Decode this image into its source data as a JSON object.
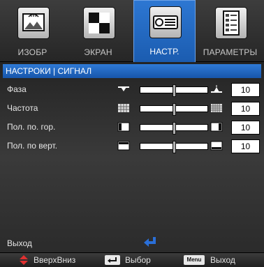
{
  "tabs": [
    {
      "label": "ИЗОБР",
      "icon": "image-icon",
      "active": false
    },
    {
      "label": "ЭКРАН",
      "icon": "screen-pattern-icon",
      "active": false
    },
    {
      "label": "НАСТР.",
      "icon": "projector-icon",
      "active": true
    },
    {
      "label": "ПАРАМЕТРЫ",
      "icon": "options-list-icon",
      "active": false
    }
  ],
  "panel": {
    "title": "НАСТРОКИ | СИГНАЛ",
    "rows": [
      {
        "label": "Фаза",
        "value": "10",
        "level": 0.5
      },
      {
        "label": "Частота",
        "value": "10",
        "level": 0.5
      },
      {
        "label": "Пол. по. гор.",
        "value": "10",
        "level": 0.5
      },
      {
        "label": "Пол. по верт.",
        "value": "10",
        "level": 0.5
      }
    ],
    "exit_label": "Выход"
  },
  "footer": {
    "nav_label": "ВверхВниз",
    "select_label": "Выбор",
    "menu_badge": "Menu",
    "exit_label": "Выход"
  },
  "colors": {
    "accent": "#1f66c2",
    "background": "#333333",
    "exit_icon": "#2a6fd8",
    "nav_icon": "#e03030"
  }
}
